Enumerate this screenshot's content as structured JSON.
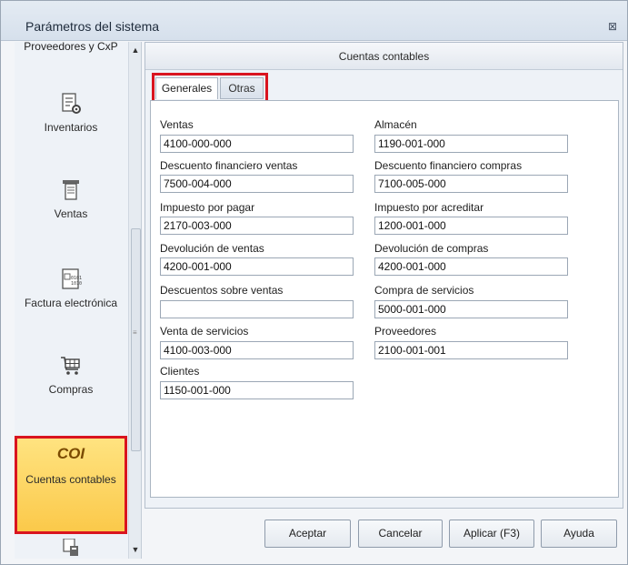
{
  "window": {
    "title": "Parámetros del sistema",
    "close_glyph": "⊠"
  },
  "sidebar": {
    "partial_label": "Proveedores y CxP",
    "items": [
      {
        "label": "Inventarios",
        "icon": "inventory-icon"
      },
      {
        "label": "Ventas",
        "icon": "receipt-icon"
      },
      {
        "label": "Factura electrónica",
        "icon": "einvoice-icon"
      },
      {
        "label": "Compras",
        "icon": "cart-icon"
      },
      {
        "label": "Cuentas contables",
        "icon": "coi-logo",
        "logo_text": "COI",
        "active": true
      }
    ],
    "scroll_up": "▲",
    "scroll_down": "▼"
  },
  "panel": {
    "header": "Cuentas contables",
    "tabs": [
      {
        "label": "Generales",
        "active": true
      },
      {
        "label": "Otras",
        "active": false
      }
    ]
  },
  "fields": {
    "left": [
      {
        "label": "Ventas",
        "value": "4100-000-000"
      },
      {
        "label": "Descuento financiero ventas",
        "value": "7500-004-000"
      },
      {
        "label": "Impuesto por pagar",
        "value": "2170-003-000"
      },
      {
        "label": "Devolución de ventas",
        "value": "4200-001-000"
      },
      {
        "label": "Descuentos sobre ventas",
        "value": ""
      },
      {
        "label": "Venta de servicios",
        "value": "4100-003-000"
      },
      {
        "label": "Clientes",
        "value": "1150-001-000"
      }
    ],
    "right": [
      {
        "label": "Almacén",
        "value": "1190-001-000"
      },
      {
        "label": "Descuento financiero compras",
        "value": "7100-005-000"
      },
      {
        "label": "Impuesto por acreditar",
        "value": "1200-001-000"
      },
      {
        "label": "Devolución de compras",
        "value": "4200-001-000"
      },
      {
        "label": "Compra de servicios",
        "value": "5000-001-000"
      },
      {
        "label": "Proveedores",
        "value": "2100-001-001"
      }
    ]
  },
  "buttons": {
    "accept": "Aceptar",
    "cancel": "Cancelar",
    "apply": "Aplicar (F3)",
    "help": "Ayuda"
  },
  "colors": {
    "highlight_border": "#d9141f",
    "active_item_bg": "#fbc94a"
  }
}
